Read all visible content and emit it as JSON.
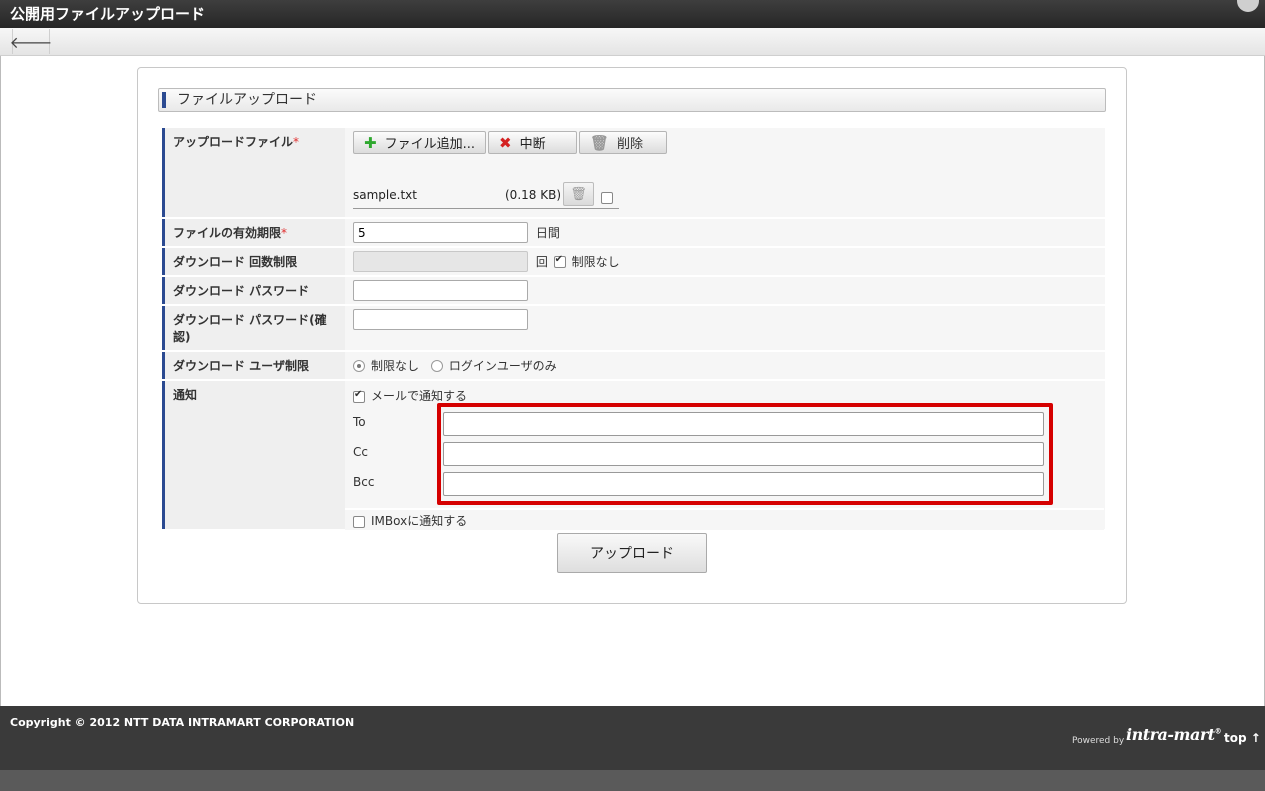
{
  "window": {
    "title": "公開用ファイルアップロード"
  },
  "toolbar": {
    "back_icon": "arrow-left-icon"
  },
  "section": {
    "heading": "ファイルアップロード"
  },
  "form": {
    "upload_file": {
      "label": "アップロードファイル",
      "required_mark": "*",
      "add_button": "ファイル追加...",
      "abort_button": "中断",
      "delete_button": "削除",
      "file": {
        "name": "sample.txt",
        "size": "(0.18 KB)",
        "checked": false
      }
    },
    "expiry": {
      "label": "ファイルの有効期限",
      "required_mark": "*",
      "value": "5",
      "unit": "日間"
    },
    "download_count": {
      "label": "ダウンロード 回数制限",
      "value": "",
      "unit": "回",
      "unlimited_label": "制限なし",
      "unlimited_checked": true
    },
    "password": {
      "label": "ダウンロード パスワード",
      "value": ""
    },
    "password_confirm": {
      "label": "ダウンロード パスワード(確認)",
      "value": ""
    },
    "user_limit": {
      "label": "ダウンロード ユーザ制限",
      "options": [
        "制限なし",
        "ログインユーザのみ"
      ],
      "selected": "制限なし"
    },
    "notify": {
      "label": "通知",
      "mail_label": "メールで通知する",
      "mail_checked": true,
      "to_label": "To",
      "cc_label": "Cc",
      "bcc_label": "Bcc",
      "to_value": "",
      "cc_value": "",
      "bcc_value": "",
      "imbox_label": "IMBoxに通知する",
      "imbox_checked": false
    },
    "submit_button": "アップロード"
  },
  "footer": {
    "copyright": "Copyright © 2012 NTT DATA INTRAMART CORPORATION",
    "powered_by": "Powered by",
    "logo_text": "intra-mart",
    "top_link": "top ↑"
  },
  "colors": {
    "accent_bar": "#2b4a91",
    "highlight_box": "#d50000",
    "required": "#e03030"
  }
}
